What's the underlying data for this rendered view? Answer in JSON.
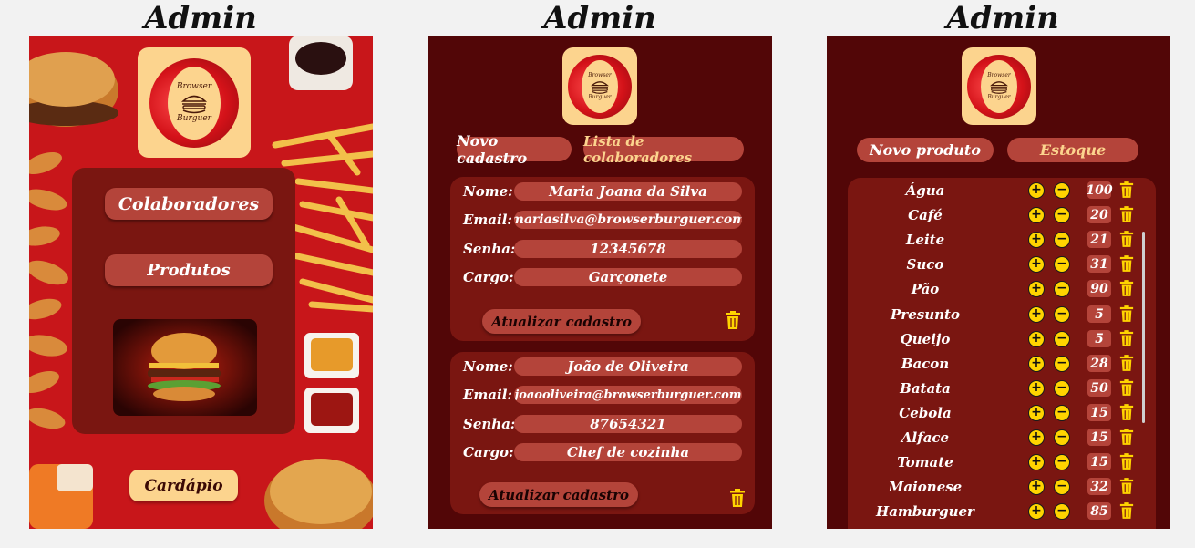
{
  "titles": [
    "Admin",
    "Admin",
    "Admin"
  ],
  "logo": {
    "line1": "Browser",
    "line2": "Burguer"
  },
  "home": {
    "buttons": {
      "colaboradores": "Colaboradores",
      "produtos": "Produtos",
      "cardapio": "Cardápio"
    }
  },
  "staff": {
    "tabs": {
      "new": "Novo cadastro",
      "list": "Lista de colaboradores"
    },
    "labels": {
      "name": "Nome:",
      "email": "Email:",
      "password": "Senha:",
      "role": "Cargo:"
    },
    "employees": [
      {
        "name": "Maria Joana da Silva",
        "email": "mariasilva@browserburguer.com",
        "password": "12345678",
        "role": "Garçonete"
      },
      {
        "name": "João de Oliveira",
        "email": "joaooliveira@browserburguer.com",
        "password": "87654321",
        "role": "Chef de cozinha"
      }
    ],
    "update_label": "Atualizar cadastro"
  },
  "stock": {
    "tabs": {
      "new": "Novo produto",
      "stock": "Estoque"
    },
    "plus": "+",
    "minus": "−",
    "items": [
      {
        "name": "Água",
        "qty": "100"
      },
      {
        "name": "Café",
        "qty": "20"
      },
      {
        "name": "Leite",
        "qty": "21"
      },
      {
        "name": "Suco",
        "qty": "31"
      },
      {
        "name": "Pão",
        "qty": "90"
      },
      {
        "name": "Presunto",
        "qty": "5"
      },
      {
        "name": "Queijo",
        "qty": "5"
      },
      {
        "name": "Bacon",
        "qty": "28"
      },
      {
        "name": "Batata",
        "qty": "50"
      },
      {
        "name": "Cebola",
        "qty": "15"
      },
      {
        "name": "Alface",
        "qty": "15"
      },
      {
        "name": "Tomate",
        "qty": "15"
      },
      {
        "name": "Maionese",
        "qty": "32"
      },
      {
        "name": "Hamburguer",
        "qty": "85"
      }
    ]
  },
  "colors": {
    "accent_dark": "#520607",
    "card": "#7a1611",
    "pill": "#b4443a",
    "cream": "#fcd48e",
    "highlight_text": "#fcd48e",
    "icon_yellow": "#ffd400"
  },
  "icons": [
    "burger-logo-icon",
    "trash-icon",
    "plus-icon",
    "minus-icon"
  ]
}
